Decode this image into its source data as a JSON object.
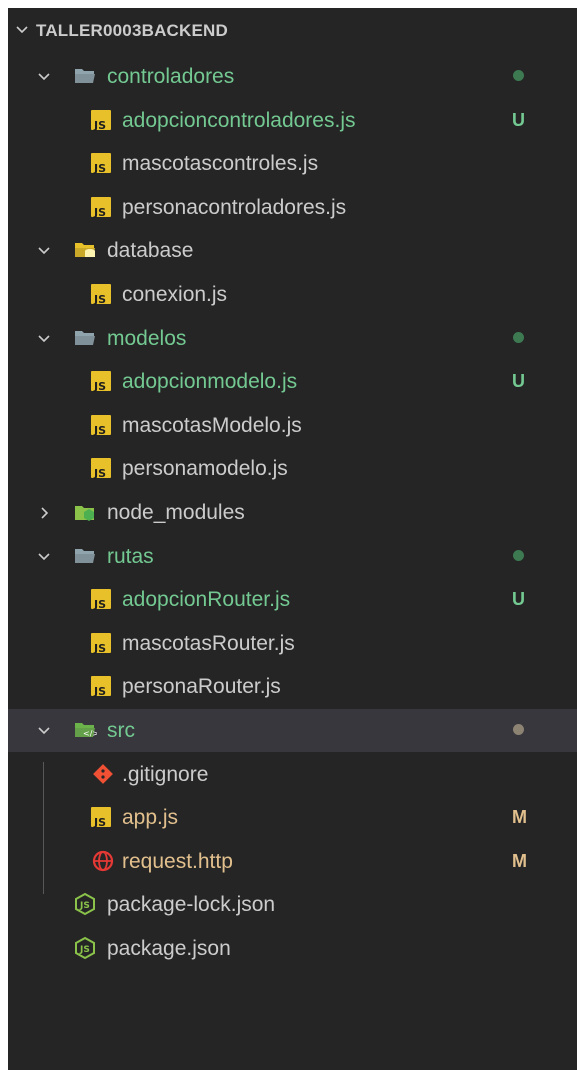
{
  "explorer": {
    "root_title": "TALLER0003BACKEND",
    "items": [
      {
        "label": "controladores",
        "icon": "folder-open-icon",
        "depth": 0,
        "expanded": true,
        "status": "dot",
        "color": "#73c991"
      },
      {
        "label": "adopcioncontroladores.js",
        "icon": "javascript-file-icon",
        "depth": 1,
        "status": "U",
        "color": "#73c991"
      },
      {
        "label": "mascotascontroles.js",
        "icon": "javascript-file-icon",
        "depth": 1,
        "status": "",
        "color": "#cccccc"
      },
      {
        "label": "personacontroladores.js",
        "icon": "javascript-file-icon",
        "depth": 1,
        "status": "",
        "color": "#cccccc"
      },
      {
        "label": "database",
        "icon": "database-folder-icon",
        "depth": 0,
        "expanded": true,
        "status": "",
        "color": "#cccccc"
      },
      {
        "label": "conexion.js",
        "icon": "javascript-file-icon",
        "depth": 1,
        "status": "",
        "color": "#cccccc"
      },
      {
        "label": "modelos",
        "icon": "folder-open-icon",
        "depth": 0,
        "expanded": true,
        "status": "dot",
        "color": "#73c991"
      },
      {
        "label": "adopcionmodelo.js",
        "icon": "javascript-file-icon",
        "depth": 1,
        "status": "U",
        "color": "#73c991"
      },
      {
        "label": "mascotasModelo.js",
        "icon": "javascript-file-icon",
        "depth": 1,
        "status": "",
        "color": "#cccccc"
      },
      {
        "label": "personamodelo.js",
        "icon": "javascript-file-icon",
        "depth": 1,
        "status": "",
        "color": "#cccccc"
      },
      {
        "label": "node_modules",
        "icon": "node-folder-icon",
        "depth": 0,
        "expanded": false,
        "status": "",
        "color": "#cccccc"
      },
      {
        "label": "rutas",
        "icon": "folder-open-icon",
        "depth": 0,
        "expanded": true,
        "status": "dot",
        "color": "#73c991"
      },
      {
        "label": "adopcionRouter.js",
        "icon": "javascript-file-icon",
        "depth": 1,
        "status": "U",
        "color": "#73c991"
      },
      {
        "label": "mascotasRouter.js",
        "icon": "javascript-file-icon",
        "depth": 1,
        "status": "",
        "color": "#cccccc"
      },
      {
        "label": "personaRouter.js",
        "icon": "javascript-file-icon",
        "depth": 1,
        "status": "",
        "color": "#cccccc"
      },
      {
        "label": "src",
        "icon": "source-folder-icon",
        "depth": 0,
        "expanded": true,
        "selected": true,
        "status": "dot-grey",
        "color": "#73c991"
      },
      {
        "label": ".gitignore",
        "icon": "git-icon",
        "depth": 1,
        "status": "",
        "color": "#cccccc"
      },
      {
        "label": "app.js",
        "icon": "javascript-file-icon",
        "depth": 1,
        "status": "M",
        "color": "#e2c08d"
      },
      {
        "label": "request.http",
        "icon": "globe-icon",
        "depth": 1,
        "status": "M",
        "color": "#e2c08d"
      },
      {
        "label": "package-lock.json",
        "icon": "node-json-icon",
        "depth": 0,
        "status": "",
        "color": "#cccccc"
      },
      {
        "label": "package.json",
        "icon": "node-json-icon",
        "depth": 0,
        "status": "",
        "color": "#cccccc"
      }
    ]
  },
  "colors": {
    "panel_bg": "#252526",
    "selected_bg": "#37373d",
    "untracked": "#73c991",
    "modified": "#e2c08d",
    "default_text": "#cccccc"
  }
}
